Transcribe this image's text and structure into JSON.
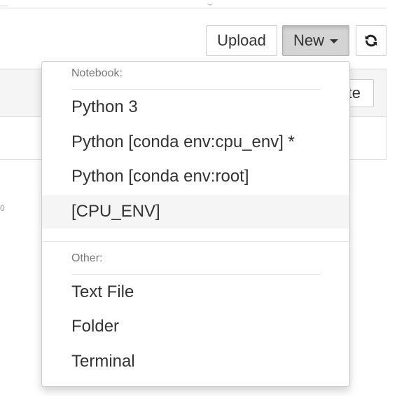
{
  "toolbar": {
    "upload_label": "Upload",
    "new_label": "New",
    "refresh_icon": "refresh-icon"
  },
  "list": {
    "partial_button_label": "te",
    "side_mark": "0"
  },
  "dropdown": {
    "notebook_header": "Notebook:",
    "notebook_items": [
      "Python 3",
      "Python [conda env:cpu_env] *",
      "Python [conda env:root]",
      "[CPU_ENV]"
    ],
    "other_header": "Other:",
    "other_items": [
      "Text File",
      "Folder",
      "Terminal"
    ]
  },
  "colors": {
    "active_item_bg": "#f5f5f5",
    "new_button_pressed_bg": "#d4d4d4"
  }
}
